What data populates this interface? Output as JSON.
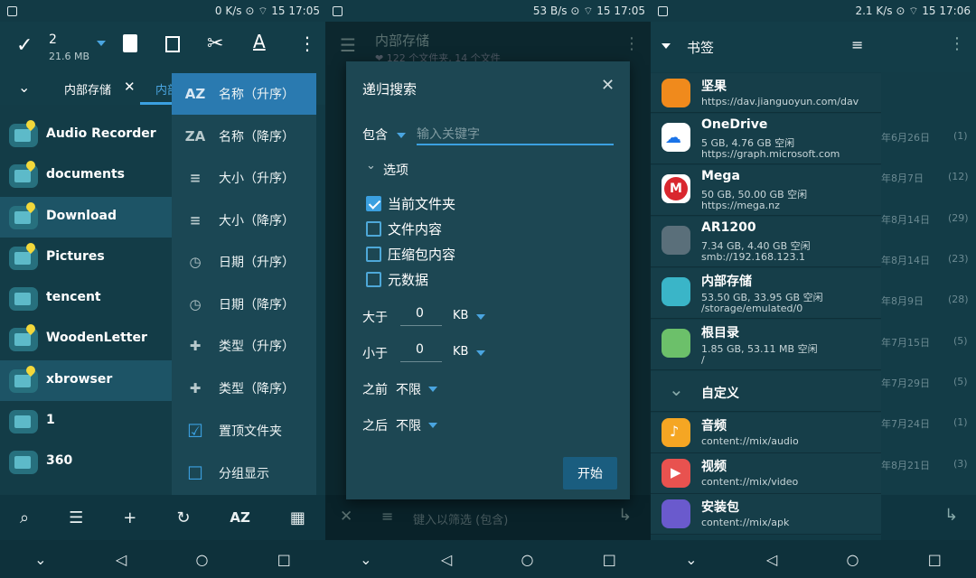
{
  "panel1": {
    "status": {
      "net": "0 K/s",
      "battery": "15",
      "time": "17:05"
    },
    "selection": {
      "count": "2",
      "size": "21.6 MB"
    },
    "tabs": [
      {
        "label": "内部存储"
      },
      {
        "label": "内部"
      }
    ],
    "files": [
      {
        "name": "Audio Recorder"
      },
      {
        "name": "documents"
      },
      {
        "name": "Download"
      },
      {
        "name": "Pictures"
      },
      {
        "name": "tencent"
      },
      {
        "name": "WoodenLetter"
      },
      {
        "name": "xbrowser"
      },
      {
        "name": "1"
      },
      {
        "name": "360"
      }
    ],
    "sort_menu": [
      {
        "icon": "AZ",
        "label": "名称（升序）"
      },
      {
        "icon": "ZA",
        "label": "名称（降序）"
      },
      {
        "icon": "≡",
        "label": "大小（升序）"
      },
      {
        "icon": "≡",
        "label": "大小（降序）"
      },
      {
        "icon": "◷",
        "label": "日期（升序）"
      },
      {
        "icon": "◷",
        "label": "日期（降序）"
      },
      {
        "icon": "✚",
        "label": "类型（升序）"
      },
      {
        "icon": "✚",
        "label": "类型（降序）"
      },
      {
        "icon": "☑",
        "label": "置顶文件夹"
      },
      {
        "icon": "☐",
        "label": "分组显示"
      }
    ],
    "bottom_bar": {
      "sort_label": "AZ"
    }
  },
  "panel2": {
    "status": {
      "net": "53 B/s",
      "battery": "15",
      "time": "17:05"
    },
    "bg_title": "内部存储",
    "bg_subtitle": "❤ 122 个文件夹, 14 个文件",
    "filter_placeholder": "键入以筛选 (包含)",
    "dialog": {
      "title": "递归搜索",
      "mode": "包含",
      "keyword_placeholder": "输入关键字",
      "options_label": "选项",
      "checks": [
        {
          "label": "当前文件夹",
          "checked": true
        },
        {
          "label": "文件内容",
          "checked": false
        },
        {
          "label": "压缩包内容",
          "checked": false
        },
        {
          "label": "元数据",
          "checked": false
        }
      ],
      "larger": {
        "label": "大于",
        "value": "0",
        "unit": "KB"
      },
      "smaller": {
        "label": "小于",
        "value": "0",
        "unit": "KB"
      },
      "before": {
        "label": "之前",
        "value": "不限"
      },
      "after": {
        "label": "之后",
        "value": "不限"
      },
      "start_button": "开始"
    }
  },
  "panel3": {
    "status": {
      "net": "2.1 K/s",
      "battery": "15",
      "time": "17:06"
    },
    "title": "书签",
    "bookmarks": [
      {
        "name": "坚果",
        "l1": "https://dav.jianguoyun.com/dav",
        "l2": "",
        "color": "#f08a1c"
      },
      {
        "name": "OneDrive",
        "l1": "5 GB, 4.76 GB 空闲",
        "l2": "https://graph.microsoft.com",
        "color": "#ffffff"
      },
      {
        "name": "Mega",
        "l1": "50 GB, 50.00 GB 空闲",
        "l2": "https://mega.nz",
        "color": "#ffffff"
      },
      {
        "name": "AR1200",
        "l1": "7.34 GB, 4.40 GB 空闲",
        "l2": "smb://192.168.123.1",
        "color": "#5a6f7a"
      },
      {
        "name": "内部存储",
        "l1": "53.50 GB, 33.95 GB 空闲",
        "l2": "/storage/emulated/0",
        "color": "#3ab5c8"
      },
      {
        "name": "根目录",
        "l1": "1.85 GB, 53.11 MB 空闲",
        "l2": "/",
        "color": "#6cc06a"
      }
    ],
    "custom_label": "自定义",
    "custom": [
      {
        "name": "音频",
        "l1": "content://mix/audio",
        "color": "#f5a623"
      },
      {
        "name": "视频",
        "l1": "content://mix/video",
        "color": "#e8524f"
      },
      {
        "name": "安装包",
        "l1": "content://mix/apk",
        "color": "#6a5acd"
      }
    ],
    "bg_rows": [
      {
        "date": "年6月26日",
        "count": "(1)"
      },
      {
        "date": "年8月7日",
        "count": "(12)"
      },
      {
        "date": "年8月14日",
        "count": "(29)"
      },
      {
        "date": "年8月14日",
        "count": "(23)"
      },
      {
        "date": "年8月9日",
        "count": "(28)"
      },
      {
        "date": "年7月15日",
        "count": "(5)"
      },
      {
        "date": "年7月29日",
        "count": "(5)"
      },
      {
        "date": "年7月24日",
        "count": "(1)"
      },
      {
        "date": "年8月21日",
        "count": "(3)"
      }
    ]
  }
}
